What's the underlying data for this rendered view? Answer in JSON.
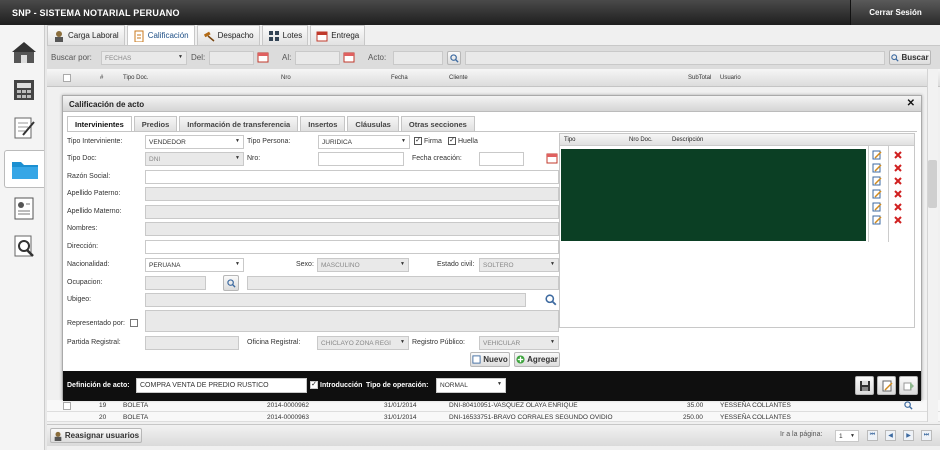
{
  "app": {
    "title": "SNP - SISTEMA NOTARIAL PERUANO",
    "logout": "Cerrar Sesión"
  },
  "tabs": [
    {
      "label": "Carga Laboral",
      "icon": "user-icon"
    },
    {
      "label": "Calificación",
      "icon": "clipboard-icon"
    },
    {
      "label": "Despacho",
      "icon": "gavel-icon"
    },
    {
      "label": "Lotes",
      "icon": "lots-icon"
    },
    {
      "label": "Entrega",
      "icon": "calendar-icon"
    }
  ],
  "filter": {
    "buscar_por": "Buscar por:",
    "buscar_por_value": "FECHAS",
    "del": "Del:",
    "al": "Al:",
    "acto": "Acto:",
    "buscar_button": "Buscar"
  },
  "grid": {
    "headers": [
      "#",
      "Tipo Doc.",
      "Nro",
      "Fecha",
      "Cliente",
      "SubTotal",
      "Usuario"
    ]
  },
  "modal": {
    "title": "Calificación de acto",
    "tabs": [
      "Intervinientes",
      "Predios",
      "Información de transferencia",
      "Insertos",
      "Cláusulas",
      "Otras secciones"
    ],
    "form": {
      "tipo_interviniente_label": "Tipo Interviniente:",
      "tipo_interviniente": "VENDEDOR",
      "tipo_persona_label": "Tipo Persona:",
      "tipo_persona": "JURIDICA",
      "firma": "Firma",
      "huella": "Huella",
      "tipo_doc_label": "Tipo Doc:",
      "tipo_doc": "DNI",
      "nro_label": "Nro:",
      "fecha_creacion_label": "Fecha creación:",
      "razon_social_label": "Razón Social:",
      "apellido_paterno_label": "Apellido Paterno:",
      "apellido_materno_label": "Apellido Materno:",
      "nombres_label": "Nombres:",
      "direccion_label": "Dirección:",
      "nacionalidad_label": "Nacionalidad:",
      "nacionalidad": "PERUANA",
      "sexo_label": "Sexo:",
      "sexo": "MASCULINO",
      "estado_civil_label": "Estado civil:",
      "estado_civil": "SOLTERO",
      "ocupacion_label": "Ocupacion:",
      "ubigeo_label": "Ubigeo:",
      "representado_label": "Representado por:",
      "partida_label": "Partida Registral:",
      "oficina_label": "Oficina Registral:",
      "oficina": "CHICLAYO ZONA REGI",
      "registro_label": "Registro Público:",
      "registro": "VEHICULAR",
      "nuevo_button": "Nuevo",
      "agregar_button": "Agregar"
    },
    "table_headers": [
      "Tipo",
      "Nro Doc.",
      "Descripción"
    ],
    "definicion_label": "Definición de acto:",
    "definicion": "COMPRA VENTA DE PREDIO RUSTICO",
    "introduccion": "Introducción",
    "tipo_operacion_label": "Tipo de operación:",
    "tipo_operacion": "NORMAL"
  },
  "rows": [
    {
      "num": "19",
      "tipo": "BOLETA",
      "nro": "2014-0000962",
      "fecha": "31/01/2014",
      "cliente": "DNI-80410951-VASQUEZ OLAYA ENRIQUE",
      "subtotal": "35.00",
      "usuario": "YESSEÑA COLLANTES"
    },
    {
      "num": "20",
      "tipo": "BOLETA",
      "nro": "2014-0000963",
      "fecha": "31/01/2014",
      "cliente": "DNI-16533751-BRAVO CORRALES SEGUNDO OVIDIO",
      "subtotal": "250.00",
      "usuario": "YESSEÑA COLLANTES"
    }
  ],
  "footer": {
    "reasignar": "Reasignar usuarios",
    "ir_a_pagina": "Ir a la página:",
    "page": "1"
  }
}
